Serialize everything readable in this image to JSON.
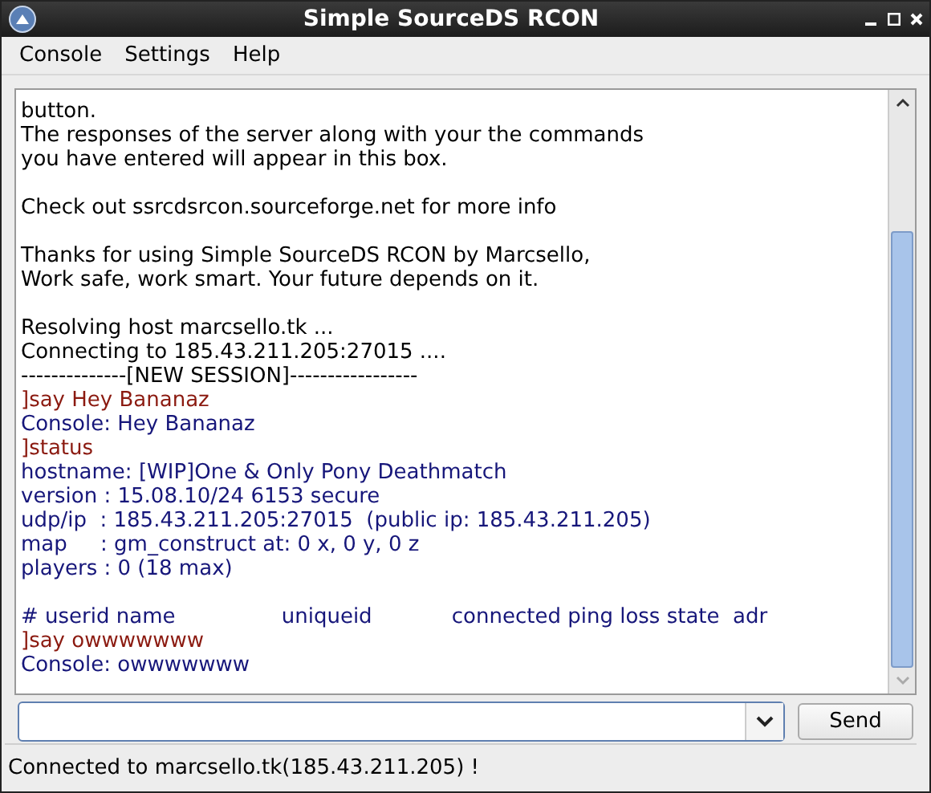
{
  "window": {
    "title": "Simple SourceDS RCON"
  },
  "menu": [
    "Console",
    "Settings",
    "Help"
  ],
  "console_blocks": [
    {
      "lines": [
        {
          "text": "button.",
          "kind": "info"
        },
        {
          "text": "The responses of the server along with your the commands",
          "kind": "info"
        },
        {
          "text": "you have entered will appear in this box.",
          "kind": "info"
        }
      ]
    },
    {
      "lines": [
        {
          "text": "Check out ssrcdsrcon.sourceforge.net for more info",
          "kind": "info"
        }
      ]
    },
    {
      "lines": [
        {
          "text": "Thanks for using Simple SourceDS RCON by Marcsello,",
          "kind": "info"
        },
        {
          "text": "Work safe, work smart. Your future depends on it.",
          "kind": "info"
        }
      ]
    },
    {
      "lines": [
        {
          "text": "Resolving host marcsello.tk ...",
          "kind": "info"
        },
        {
          "text": "Connecting to 185.43.211.205:27015 ....",
          "kind": "info"
        },
        {
          "text": "--------------[NEW SESSION]-----------------",
          "kind": "info"
        },
        {
          "text": "]say Hey Bananaz",
          "kind": "command"
        },
        {
          "text": "Console: Hey Bananaz",
          "kind": "response"
        },
        {
          "text": "]status",
          "kind": "command"
        },
        {
          "text": "hostname: [WIP]One & Only Pony Deathmatch",
          "kind": "response"
        },
        {
          "text": "version : 15.08.10/24 6153 secure",
          "kind": "response"
        },
        {
          "text": "udp/ip  : 185.43.211.205:27015  (public ip: 185.43.211.205)",
          "kind": "response"
        },
        {
          "text": "map     : gm_construct at: 0 x, 0 y, 0 z",
          "kind": "response"
        },
        {
          "text": "players : 0 (18 max)",
          "kind": "response"
        }
      ]
    },
    {
      "lines": [
        {
          "text": "# userid name                uniqueid            connected ping loss state  adr",
          "kind": "response"
        },
        {
          "text": "]say owwwwwww",
          "kind": "command"
        },
        {
          "text": "Console: owwwwwww",
          "kind": "response"
        }
      ]
    }
  ],
  "send_button": "Send",
  "status_bar": "Connected to marcsello.tk(185.43.211.205) !"
}
